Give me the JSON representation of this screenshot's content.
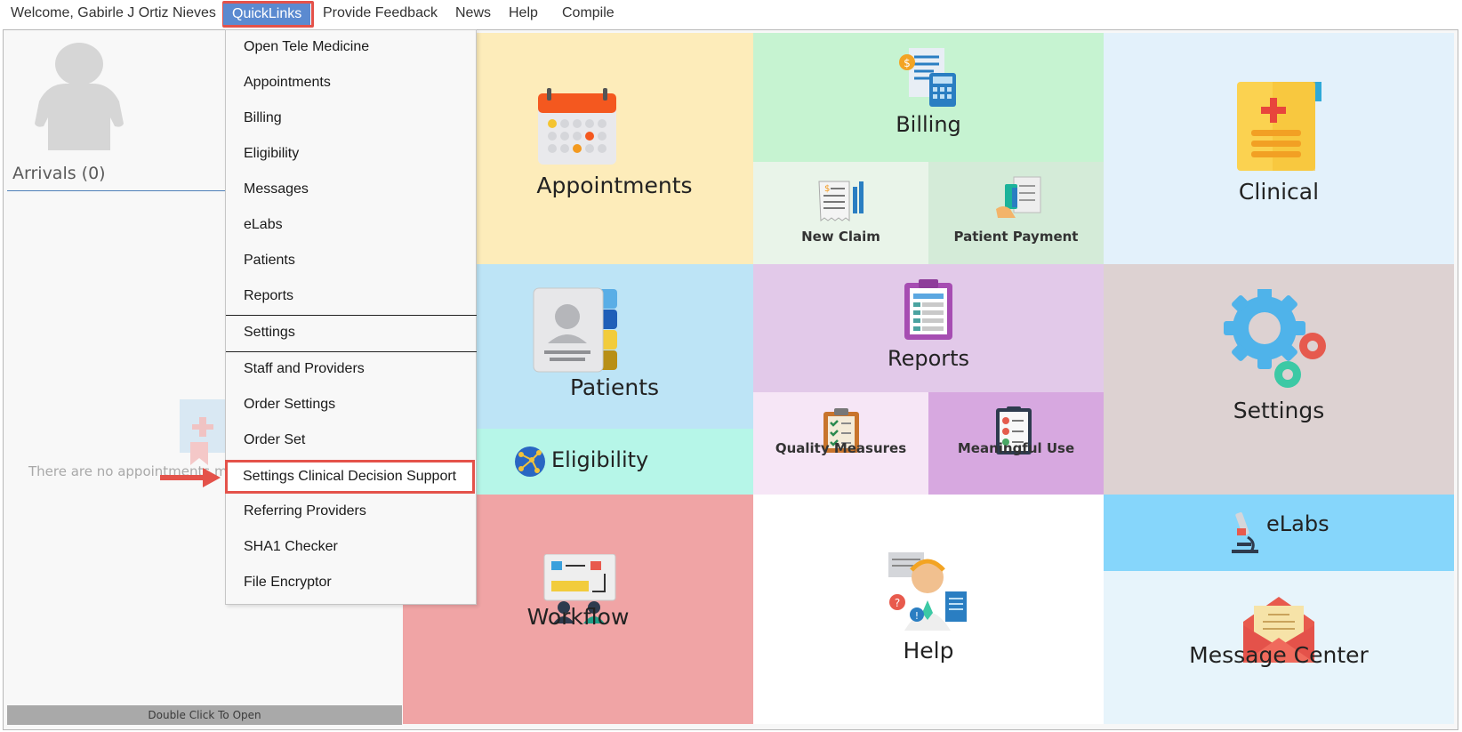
{
  "menubar": {
    "welcome": "Welcome, Gabirle J Ortiz Nieves",
    "quicklinks": "QuickLinks",
    "feedback": "Provide Feedback",
    "news": "News",
    "help": "Help",
    "compile": "Compile"
  },
  "left_panel": {
    "arrivals": "Arrivals (0)",
    "empty_text": "There are no appointments ma",
    "open_hint": "Double Click To Open"
  },
  "quicklinks_menu": {
    "items": [
      "Open Tele Medicine",
      "Appointments",
      "Billing",
      "Eligibility",
      "Messages",
      "eLabs",
      "Patients",
      "Reports",
      "Settings",
      "Staff and Providers",
      "Order Settings",
      "Order Set",
      "Settings Clinical Decision Support",
      "Referring Providers",
      "SHA1 Checker",
      "File Encryptor"
    ],
    "highlighted_item": "Settings Clinical Decision Support"
  },
  "tiles": {
    "appointments": "Appointments",
    "billing": "Billing",
    "new_claim": "New Claim",
    "patient_payment": "Patient Payment",
    "clinical": "Clinical",
    "patients": "Patients",
    "eligibility": "Eligibility",
    "reports": "Reports",
    "quality_measures": "Quality Measures",
    "meaningful_use": "Meaningful Use",
    "settings": "Settings",
    "workflow": "Workflow",
    "help": "Help",
    "elabs": "eLabs",
    "message_center": "Message Center"
  },
  "colors": {
    "accent_blue": "#5b8ad0",
    "highlight_red": "#e4524a"
  },
  "icons": {
    "appointments": "calendar-icon",
    "billing": "billing-documents-icon",
    "new_claim": "claim-receipt-icon",
    "patient_payment": "payment-card-icon",
    "clinical": "clinical-document-icon",
    "patients": "patient-contacts-icon",
    "eligibility": "globe-network-icon",
    "reports": "clipboard-report-icon",
    "quality_measures": "checklist-clipboard-icon",
    "meaningful_use": "status-list-icon",
    "settings": "gears-icon",
    "workflow": "presentation-board-icon",
    "help": "support-agent-icon",
    "elabs": "microscope-icon",
    "message_center": "envelope-icon"
  }
}
